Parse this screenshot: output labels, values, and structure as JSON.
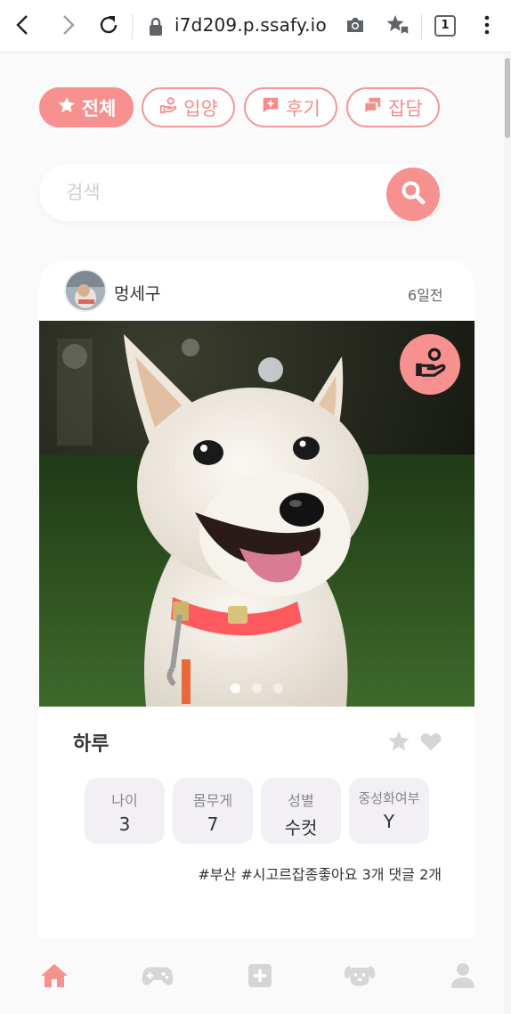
{
  "browser": {
    "url": "i7d209.p.ssafy.io",
    "tab_count": "1"
  },
  "categories": [
    {
      "label": "전체",
      "icon": "star-icon",
      "active": true
    },
    {
      "label": "입양",
      "icon": "hand-giving-icon",
      "active": false
    },
    {
      "label": "후기",
      "icon": "chat-plus-icon",
      "active": false
    },
    {
      "label": "잡담",
      "icon": "chat-bubbles-icon",
      "active": false
    }
  ],
  "search": {
    "placeholder": "검색"
  },
  "post": {
    "author": "멍세구",
    "time": "6일전",
    "pet_name": "하루",
    "image_count": 3,
    "active_image_index": 0,
    "info": [
      {
        "label": "나이",
        "value": "3"
      },
      {
        "label": "몸무게",
        "value": "7"
      },
      {
        "label": "성별",
        "value": "수컷"
      },
      {
        "label": "중성화여부",
        "value": "Y"
      }
    ],
    "tags_line": "#부산 #시고르잡종좋아요 3개 댓글 2개"
  },
  "bottom_nav": [
    {
      "name": "home-icon",
      "active": true
    },
    {
      "name": "gamepad-icon",
      "active": false
    },
    {
      "name": "plus-square-icon",
      "active": false
    },
    {
      "name": "dog-icon",
      "active": false
    },
    {
      "name": "user-icon",
      "active": false
    }
  ],
  "colors": {
    "accent": "#f79190",
    "inactive_icon": "#d6d6d6",
    "info_bg": "#f3f0f5"
  }
}
